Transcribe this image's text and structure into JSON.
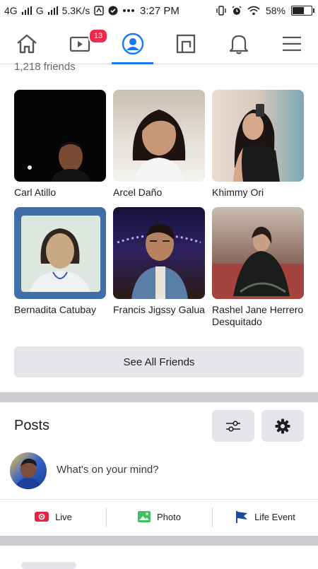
{
  "status_bar": {
    "network": "4G",
    "signal_label": "G",
    "speed": "5.3K/s",
    "time": "3:27 PM",
    "battery": "58%",
    "battery_level": 0.58
  },
  "nav": {
    "items": [
      {
        "name": "home"
      },
      {
        "name": "watch",
        "badge": "13"
      },
      {
        "name": "profile",
        "active": true
      },
      {
        "name": "marketplace"
      },
      {
        "name": "notifications"
      },
      {
        "name": "menu"
      }
    ]
  },
  "friends": {
    "count_label": "1,218 friends",
    "list": [
      {
        "name": "Carl Atillo"
      },
      {
        "name": "Arcel Daño"
      },
      {
        "name": "Khimmy Ori"
      },
      {
        "name": "Bernadita Catubay"
      },
      {
        "name": "Francis Jigssy Galua"
      },
      {
        "name": "Rashel Jane Herrero Desquitado"
      }
    ],
    "see_all_label": "See All Friends"
  },
  "posts": {
    "title": "Posts",
    "composer_placeholder": "What's on your mind?",
    "actions": [
      {
        "label": "Live",
        "icon": "live-icon"
      },
      {
        "label": "Photo",
        "icon": "photo-icon"
      },
      {
        "label": "Life Event",
        "icon": "life-event-icon"
      }
    ]
  },
  "colors": {
    "accent": "#1877f2",
    "badge": "#f02849",
    "live": "#e42645",
    "photo": "#45bd62",
    "life_event": "#1b4b9a"
  }
}
